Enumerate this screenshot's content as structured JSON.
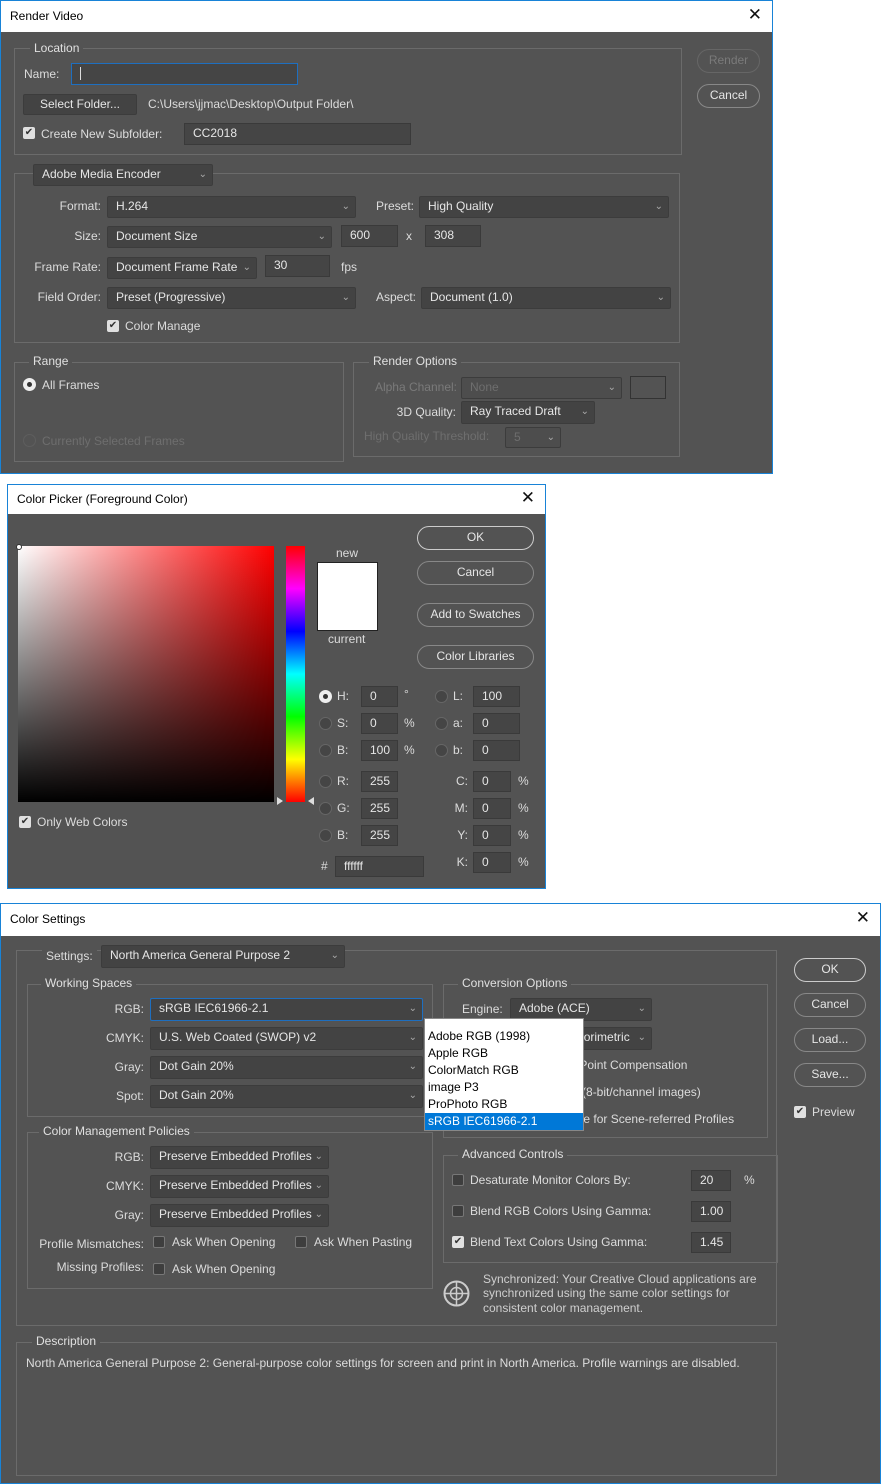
{
  "render_video": {
    "title": "Render Video",
    "close": "✕",
    "location": {
      "legend": "Location",
      "name_label": "Name:",
      "name_value": "",
      "select_folder": "Select Folder...",
      "folder_path": "C:\\Users\\jjmac\\Desktop\\Output Folder\\",
      "subfolder_label": "Create New Subfolder:",
      "subfolder_checked": true,
      "subfolder_value": "CC2018"
    },
    "encoder": "Adobe Media Encoder",
    "format_label": "Format:",
    "format": "H.264",
    "preset_label": "Preset:",
    "preset": "High Quality",
    "size_label": "Size:",
    "size": "Document Size",
    "width": "600",
    "x": "x",
    "height": "308",
    "frame_rate_label": "Frame Rate:",
    "frame_rate": "Document Frame Rate",
    "fps_value": "30",
    "fps": "fps",
    "field_order_label": "Field Order:",
    "field_order": "Preset (Progressive)",
    "aspect_label": "Aspect:",
    "aspect": "Document (1.0)",
    "color_manage": "Color Manage",
    "color_manage_checked": true,
    "range": {
      "legend": "Range",
      "all_frames": "All Frames",
      "selected_frames": "Currently Selected Frames"
    },
    "render_options": {
      "legend": "Render Options",
      "alpha_label": "Alpha Channel:",
      "alpha": "None",
      "quality_label": "3D Quality:",
      "quality": "Ray Traced Draft",
      "threshold_label": "High Quality Threshold:",
      "threshold": "5"
    },
    "render_button": "Render",
    "cancel_button": "Cancel"
  },
  "color_picker": {
    "title": "Color Picker (Foreground Color)",
    "close": "✕",
    "new_label": "new",
    "current_label": "current",
    "current_color": "#ffffff",
    "buttons": {
      "ok": "OK",
      "cancel": "Cancel",
      "swatches": "Add to Swatches",
      "libraries": "Color Libraries"
    },
    "hsb": [
      {
        "label": "H:",
        "value": "0",
        "unit": "°"
      },
      {
        "label": "S:",
        "value": "0",
        "unit": "%"
      },
      {
        "label": "B:",
        "value": "100",
        "unit": "%"
      }
    ],
    "rgb": [
      {
        "label": "R:",
        "value": "255"
      },
      {
        "label": "G:",
        "value": "255"
      },
      {
        "label": "B:",
        "value": "255"
      }
    ],
    "lab": [
      {
        "label": "L:",
        "value": "100"
      },
      {
        "label": "a:",
        "value": "0"
      },
      {
        "label": "b:",
        "value": "0"
      }
    ],
    "cmyk": [
      {
        "label": "C:",
        "value": "0",
        "unit": "%"
      },
      {
        "label": "M:",
        "value": "0",
        "unit": "%"
      },
      {
        "label": "Y:",
        "value": "0",
        "unit": "%"
      },
      {
        "label": "K:",
        "value": "0",
        "unit": "%"
      }
    ],
    "hex_label": "#",
    "hex": "ffffff",
    "web_colors": "Only Web Colors",
    "web_colors_checked": true
  },
  "color_settings": {
    "title": "Color Settings",
    "close": "✕",
    "settings_label": "Settings:",
    "settings": "North America General Purpose 2",
    "working_spaces": {
      "legend": "Working Spaces",
      "rows": [
        {
          "label": "RGB:",
          "value": "sRGB IEC61966-2.1"
        },
        {
          "label": "CMYK:",
          "value": "U.S. Web Coated (SWOP) v2"
        },
        {
          "label": "Gray:",
          "value": "Dot Gain 20%"
        },
        {
          "label": "Spot:",
          "value": "Dot Gain 20%"
        }
      ]
    },
    "rgb_options": [
      "Adobe RGB (1998)",
      "Apple RGB",
      "ColorMatch RGB",
      "image P3",
      "ProPhoto RGB",
      "sRGB IEC61966-2.1"
    ],
    "policies": {
      "legend": "Color Management Policies",
      "rows": [
        {
          "label": "RGB:",
          "value": "Preserve Embedded Profiles"
        },
        {
          "label": "CMYK:",
          "value": "Preserve Embedded Profiles"
        },
        {
          "label": "Gray:",
          "value": "Preserve Embedded Profiles"
        }
      ],
      "mismatch_label": "Profile Mismatches:",
      "ask_opening": "Ask When Opening",
      "ask_pasting": "Ask When Pasting",
      "missing_label": "Missing Profiles:",
      "missing_opening": "Ask When Opening"
    },
    "conversion": {
      "legend": "Conversion Options",
      "engine_label": "Engine:",
      "engine": "Adobe (ACE)",
      "intent": "Relative Colorimetric",
      "bpc": "Use Black Point Compensation",
      "dither": "Use Dither (8-bit/channel images)",
      "scene": "Compensate for Scene-referred Profiles"
    },
    "advanced": {
      "legend": "Advanced Controls",
      "desaturate": "Desaturate Monitor Colors By:",
      "desaturate_value": "20",
      "percent": "%",
      "blend_rgb": "Blend RGB Colors Using Gamma:",
      "blend_rgb_value": "1.00",
      "blend_text": "Blend Text Colors Using Gamma:",
      "blend_text_value": "1.45",
      "blend_text_checked": true
    },
    "sync_lines": [
      "Synchronized: Your Creative Cloud applications are",
      "synchronized using the same color settings for",
      "consistent color management."
    ],
    "description": {
      "legend": "Description",
      "text": "North America General Purpose 2:  General-purpose color settings for screen and print in North America. Profile warnings are disabled."
    },
    "buttons": {
      "ok": "OK",
      "cancel": "Cancel",
      "load": "Load...",
      "save": "Save..."
    },
    "preview": "Preview",
    "preview_checked": true
  }
}
